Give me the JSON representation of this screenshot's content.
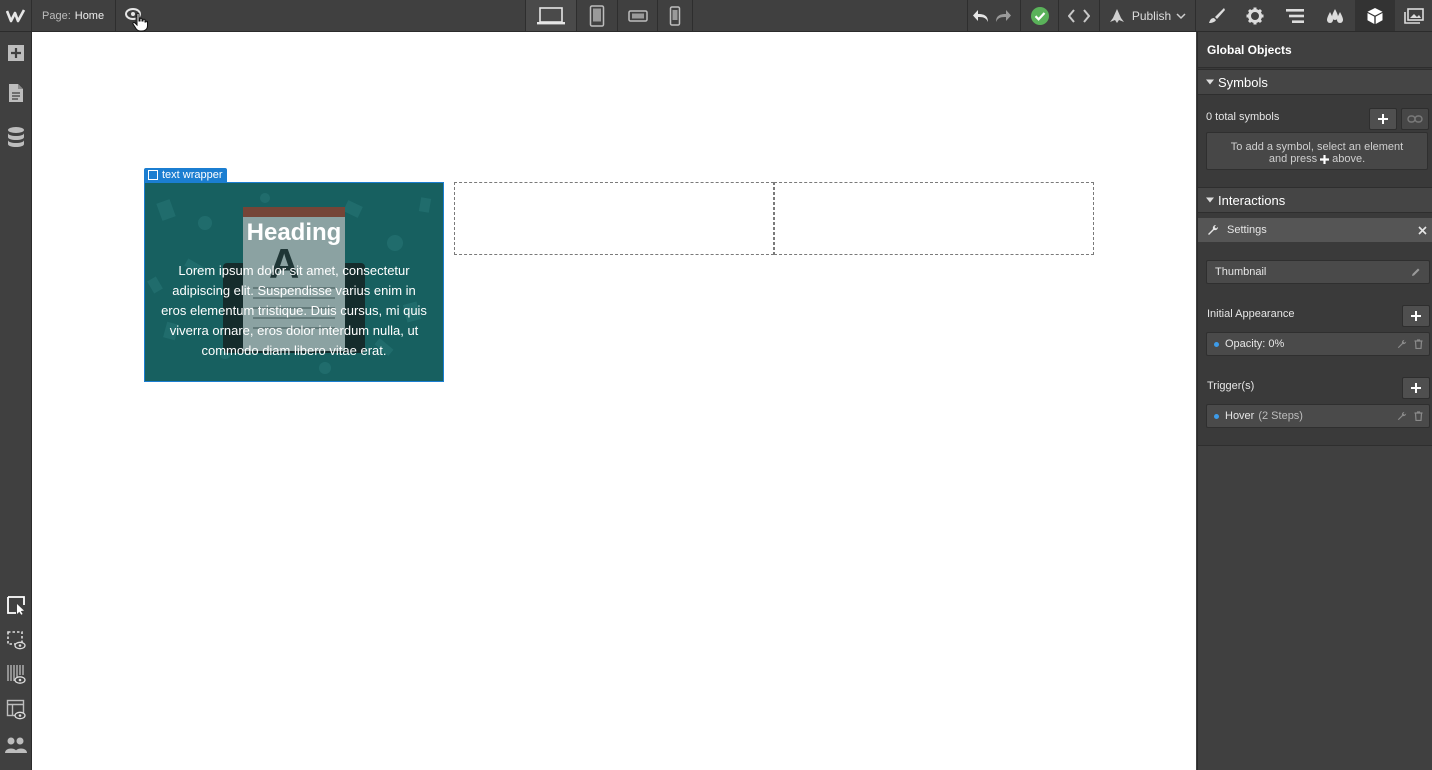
{
  "topbar": {
    "page_label": "Page:",
    "page_name": "Home",
    "publish_label": "Publish"
  },
  "canvas": {
    "selected_tag": "text wrapper",
    "card_heading": "Heading",
    "card_body": "Lorem ipsum dolor sit amet, consectetur adipiscing elit. Suspendisse varius enim in eros elementum tristique. Duis cursus, mi quis viverra ornare, eros dolor interdum nulla, ut commodo diam libero vitae erat."
  },
  "panel": {
    "title": "Global Objects",
    "symbols": {
      "heading": "Symbols",
      "count_text": "0 total symbols",
      "hint_line1": "To add a symbol, select an element",
      "hint_line2_pre": "and press",
      "hint_line2_post": "above."
    },
    "interactions": {
      "heading": "Interactions",
      "settings_label": "Settings",
      "thumbnail_label": "Thumbnail",
      "initial_appearance_label": "Initial Appearance",
      "opacity_item": "Opacity: 0%",
      "triggers_label": "Trigger(s)",
      "hover_item": "Hover",
      "hover_steps": "(2 Steps)"
    }
  },
  "colors": {
    "accent": "#1b7ed1",
    "success": "#5ab25a",
    "card_bg": "#1d6f6f"
  },
  "icons": {
    "logo": "webflow-logo-icon",
    "preview": "eye-icon",
    "desktop": "desktop-icon",
    "tablet": "tablet-icon",
    "landscape": "phone-landscape-icon",
    "portrait": "phone-portrait-icon",
    "undo": "undo-icon",
    "redo": "redo-icon",
    "status": "check-circle-icon",
    "code": "code-icon",
    "publish": "rocket-icon",
    "style": "brush-icon",
    "settings": "gear-icon",
    "navigator": "navigator-icon",
    "swatches": "drops-icon",
    "global": "cube-icon",
    "assets": "images-icon"
  }
}
